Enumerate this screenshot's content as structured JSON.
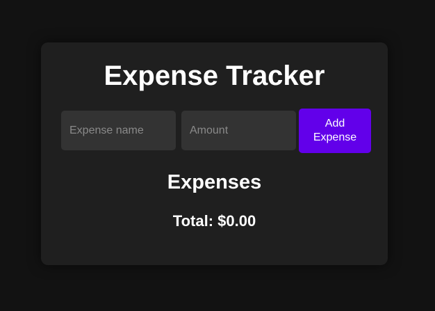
{
  "app": {
    "title": "Expense Tracker"
  },
  "form": {
    "name_placeholder": "Expense name",
    "name_value": "",
    "amount_placeholder": "Amount",
    "amount_value": "",
    "add_button_label": "Add Expense"
  },
  "expenses": {
    "heading": "Expenses",
    "items": [],
    "total_text": "Total: $0.00"
  },
  "colors": {
    "background": "#121212",
    "card": "#1f1f1f",
    "input": "#333333",
    "accent": "#6200ea"
  }
}
